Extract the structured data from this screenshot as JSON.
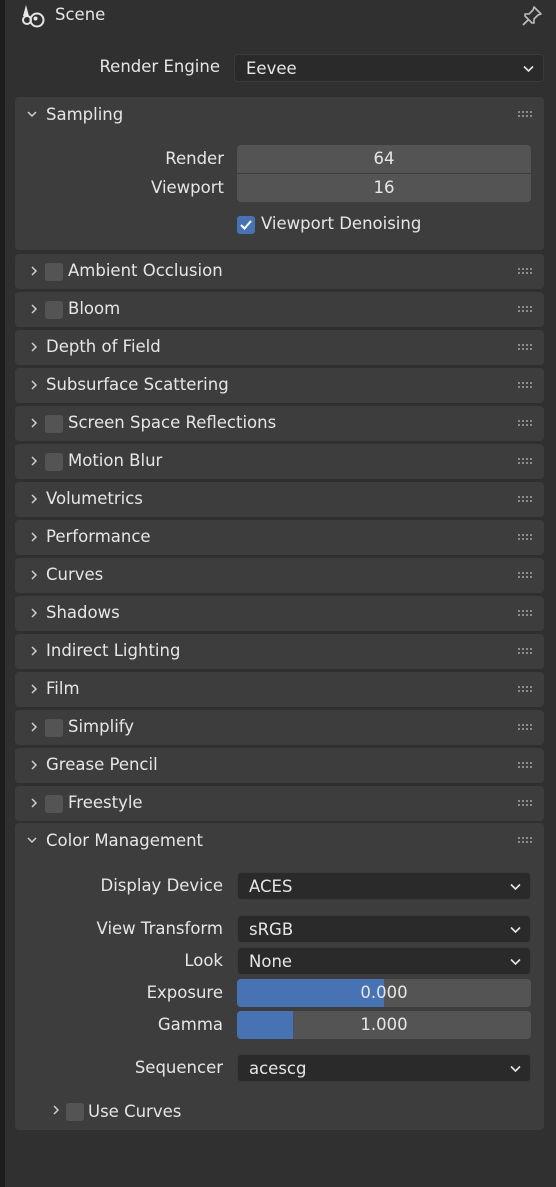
{
  "header": {
    "title": "Scene",
    "icon": "scene-icon",
    "pin_icon": "pin-icon"
  },
  "render_engine": {
    "label": "Render Engine",
    "value": "Eevee"
  },
  "sampling": {
    "title": "Sampling",
    "render_label": "Render",
    "render_value": "64",
    "viewport_label": "Viewport",
    "viewport_value": "16",
    "denoise_label": "Viewport Denoising",
    "denoise_checked": true
  },
  "panels": [
    {
      "title": "Ambient Occlusion",
      "checkbox": true
    },
    {
      "title": "Bloom",
      "checkbox": true
    },
    {
      "title": "Depth of Field",
      "checkbox": false
    },
    {
      "title": "Subsurface Scattering",
      "checkbox": false
    },
    {
      "title": "Screen Space Reflections",
      "checkbox": true
    },
    {
      "title": "Motion Blur",
      "checkbox": true
    },
    {
      "title": "Volumetrics",
      "checkbox": false
    },
    {
      "title": "Performance",
      "checkbox": false
    },
    {
      "title": "Curves",
      "checkbox": false
    },
    {
      "title": "Shadows",
      "checkbox": false
    },
    {
      "title": "Indirect Lighting",
      "checkbox": false
    },
    {
      "title": "Film",
      "checkbox": false
    },
    {
      "title": "Simplify",
      "checkbox": true
    },
    {
      "title": "Grease Pencil",
      "checkbox": false
    },
    {
      "title": "Freestyle",
      "checkbox": true
    }
  ],
  "color_management": {
    "title": "Color Management",
    "display_device_label": "Display Device",
    "display_device_value": "ACES",
    "view_transform_label": "View Transform",
    "view_transform_value": "sRGB",
    "look_label": "Look",
    "look_value": "None",
    "exposure_label": "Exposure",
    "exposure_value": "0.000",
    "exposure_fill": 0.5,
    "gamma_label": "Gamma",
    "gamma_value": "1.000",
    "gamma_fill": 0.19,
    "sequencer_label": "Sequencer",
    "sequencer_value": "acescg",
    "use_curves_label": "Use Curves"
  },
  "colors": {
    "accent": "#4772b3",
    "panel": "#3d3d3d",
    "background": "#303030",
    "field": "#545454"
  }
}
